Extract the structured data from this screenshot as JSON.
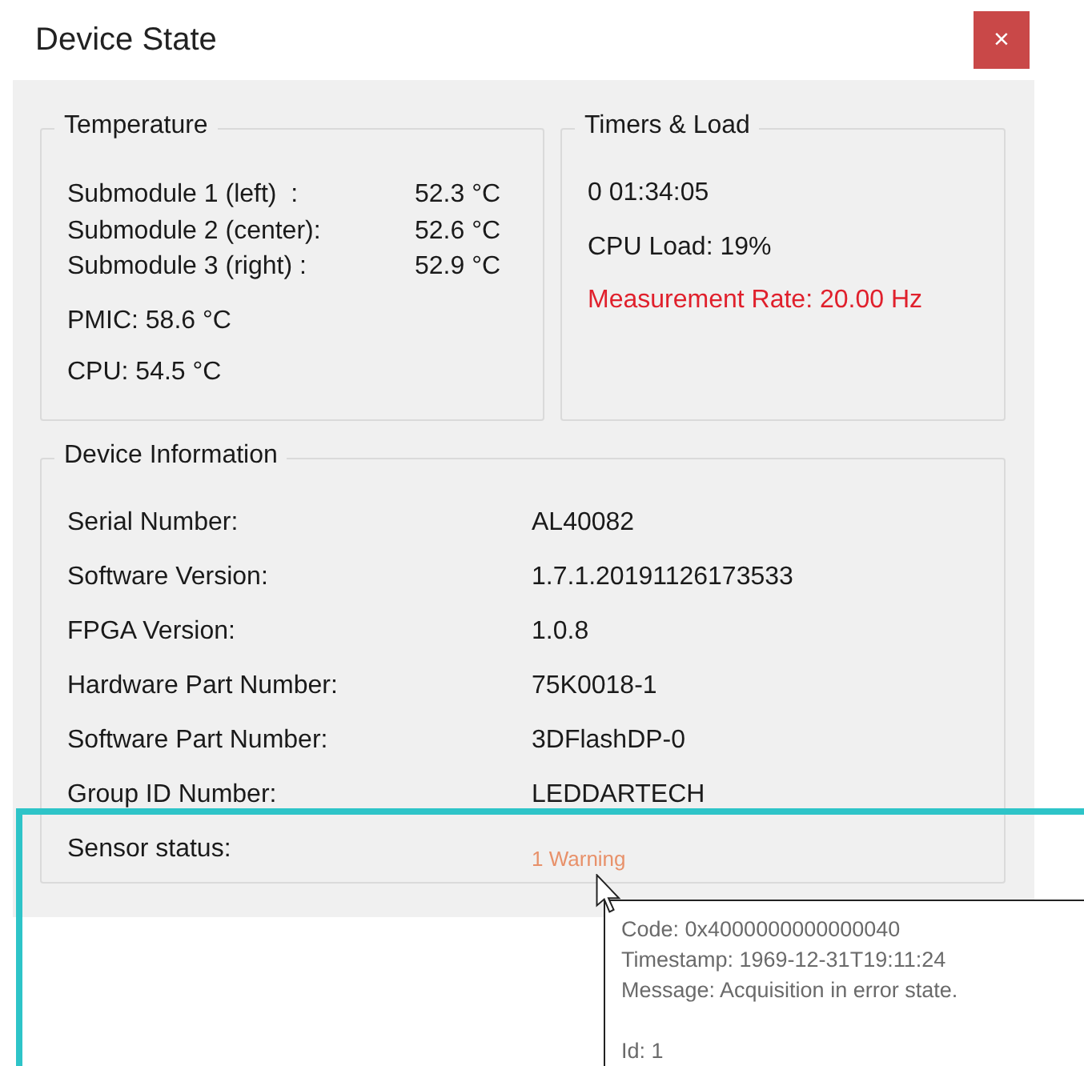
{
  "window": {
    "title": "Device State",
    "close_button": "×"
  },
  "temperature": {
    "title": "Temperature",
    "submodules": [
      {
        "label": "Submodule 1 (left)  :",
        "value": "52.3 °C"
      },
      {
        "label": "Submodule 2 (center):",
        "value": "52.6 °C"
      },
      {
        "label": "Submodule 3 (right) :",
        "value": "52.9 °C"
      }
    ],
    "pmic": "PMIC: 58.6 °C",
    "cpu": "CPU: 54.5 °C"
  },
  "timers": {
    "title": "Timers & Load",
    "lines": [
      {
        "text": "0 01:34:05",
        "alert": false
      },
      {
        "text": "CPU Load: 19%",
        "alert": false
      },
      {
        "text": "Measurement Rate: 20.00 Hz",
        "alert": true
      }
    ]
  },
  "device_information": {
    "title": "Device Information",
    "rows": [
      {
        "label": "Serial Number:",
        "value": "AL40082"
      },
      {
        "label": "Software Version:",
        "value": "1.7.1.20191126173533"
      },
      {
        "label": "FPGA Version:",
        "value": "1.0.8"
      },
      {
        "label": "Hardware Part Number:",
        "value": "75K0018-1"
      },
      {
        "label": "Software Part Number:",
        "value": "3DFlashDP-0"
      },
      {
        "label": "Group ID Number:",
        "value": "LEDDARTECH"
      }
    ],
    "sensor_status": {
      "label": "Sensor status:",
      "value": "1 Warning"
    }
  },
  "tooltip": {
    "lines": [
      "Code: 0x4000000000000040",
      "Timestamp: 1969-12-31T19:11:24",
      "Message: Acquisition in error state."
    ],
    "id": "Id: 1"
  }
}
